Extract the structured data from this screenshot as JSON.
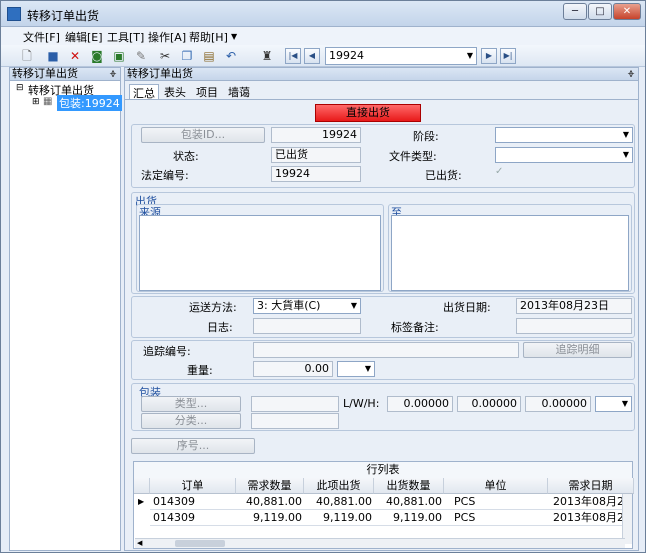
{
  "window": {
    "title": "转移订单出货"
  },
  "menu": [
    "文件[F]",
    "编辑[E]",
    "工具[T]",
    "操作[A]",
    "帮助[H]"
  ],
  "toolbar": {
    "record_value": "19924"
  },
  "left_panel": {
    "header": "转移订单出货",
    "tree_root": "转移订单出货",
    "tree_child": "包装:19924"
  },
  "right_panel": {
    "header": "转移订单出货",
    "tabs": [
      "汇总",
      "表头",
      "项目",
      "墙蔼"
    ]
  },
  "form": {
    "direct_ship_button": "直接出货",
    "package_id_button": "包装ID...",
    "package_id_value": "19924",
    "stage_label": "阶段:",
    "status_label": "状态:",
    "status_value": "已出货",
    "file_type_label": "文件类型:",
    "legal_no_label": "法定编号:",
    "legal_no_value": "19924",
    "shipped_label": "已出货:",
    "shipped_check": "✓",
    "ship_group": "出货",
    "from_label": "来源",
    "to_label": "至",
    "ship_method_label": "运送方法:",
    "ship_method_value": "3: 大貨車(C)",
    "ship_date_label": "出货日期:",
    "ship_date_value": "2013年08月23日",
    "log_label": "日志:",
    "tag_note_label": "标签备注:",
    "tracking_label": "追踪编号:",
    "tracking_detail_button": "追踪明细",
    "weight_label": "重量:",
    "weight_value": "0.00",
    "pack_group": "包装",
    "type_button": "类型...",
    "category_button": "分类...",
    "lwh_label": "L/W/H:",
    "l_value": "0.00000",
    "w_value": "0.00000",
    "h_value": "0.00000",
    "seq_button": "序号..."
  },
  "grid": {
    "caption": "行列表",
    "columns": [
      "订单",
      "需求数量",
      "此项出货",
      "出货数量",
      "单位",
      "需求日期"
    ],
    "rows": [
      [
        "014309",
        "40,881.00",
        "40,881.00",
        "40,881.00",
        "PCS",
        "2013年08月2"
      ],
      [
        "014309",
        "9,119.00",
        "9,119.00",
        "9,119.00",
        "PCS",
        "2013年08月2"
      ]
    ]
  },
  "colors": {
    "accent": "#1f4f9f",
    "danger": "#e81a1a",
    "frame": "#e6edf7"
  }
}
